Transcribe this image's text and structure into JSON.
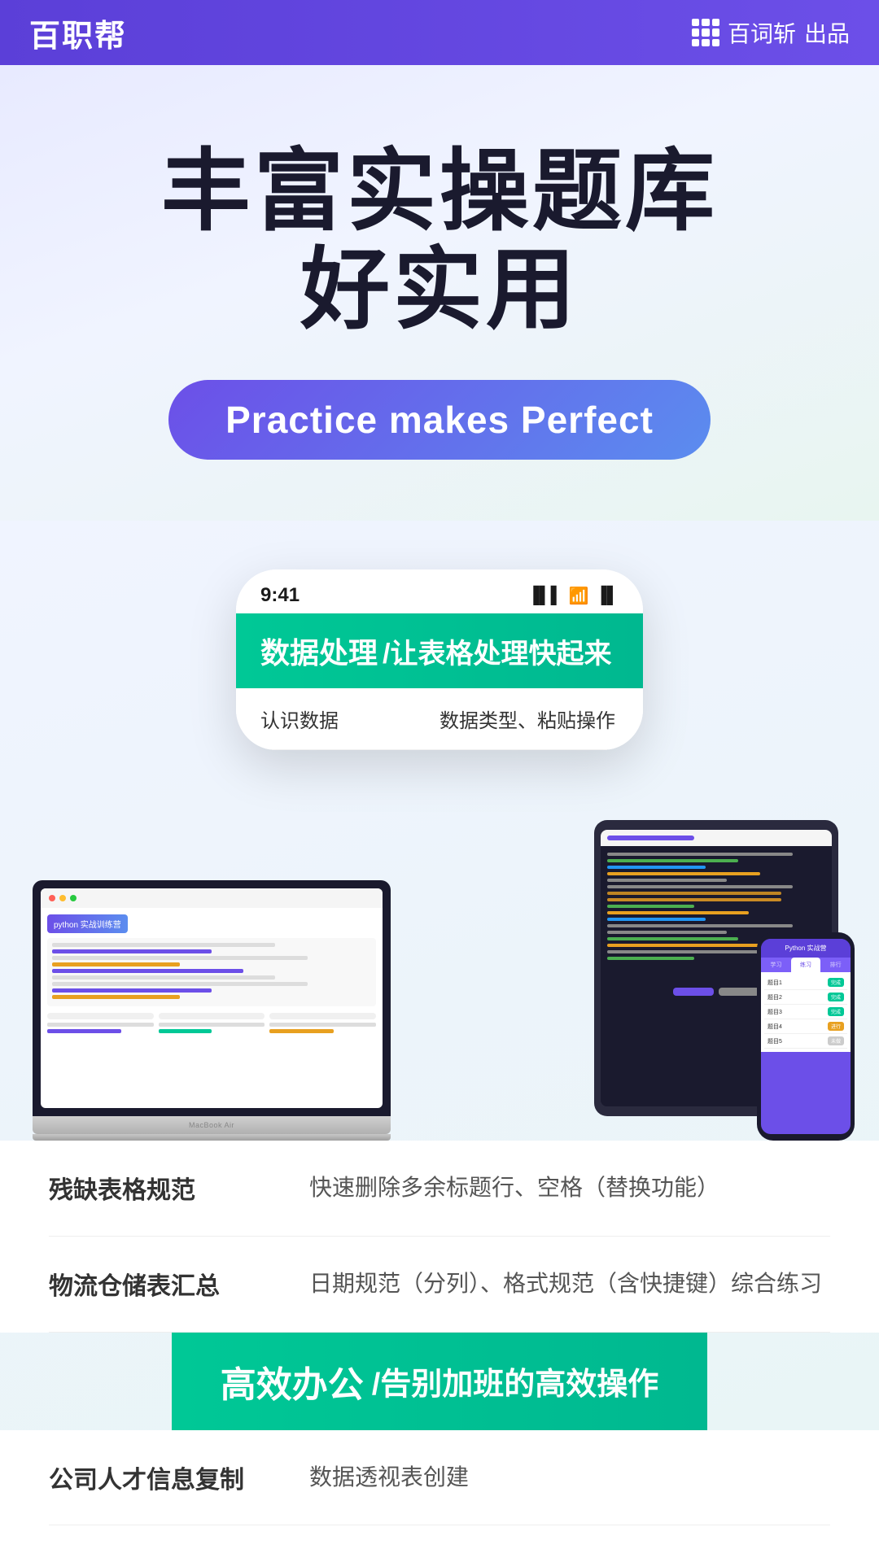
{
  "header": {
    "logo": "百职帮",
    "brand_icon_label": "grid-icon",
    "brand_name": "百词斩",
    "brand_suffix": "出品"
  },
  "hero": {
    "title_line1": "丰富实操题库",
    "title_line2": "好实用",
    "practice_badge": "Practice makes Perfect"
  },
  "phone_mockup": {
    "time": "9:41",
    "data_processing_label": "数据处理",
    "data_processing_subtitle": "/让表格处理快起来",
    "list_rows": [
      {
        "left": "认识数据",
        "right": "数据类型、粘贴操作"
      }
    ]
  },
  "content_rows": [
    {
      "left": "残缺表格规范",
      "right": "快速删除多余标题行、空格（替换功能）"
    },
    {
      "left": "物流仓储表汇总",
      "right": "日期规范（分列）、格式规范（含快捷键）综合练习"
    }
  ],
  "efficiency_banner": {
    "label": "高效办公",
    "subtitle": "/告别加班的高效操作"
  },
  "bottom_rows": [
    {
      "left": "公司人才信息复制",
      "right": "数据透视表创建"
    }
  ],
  "laptop": {
    "label": "MacBook Air",
    "python_label": "python 实战训练营"
  },
  "small_phone": {
    "header": "Python 实战营",
    "tabs": [
      "学习",
      "练习",
      "排行"
    ],
    "rows": [
      {
        "label": "题目1",
        "badge": "完成"
      },
      {
        "label": "题目2",
        "badge": "完成"
      },
      {
        "label": "题目3",
        "badge": "完成"
      },
      {
        "label": "题目4",
        "badge": "进行"
      },
      {
        "label": "题目5",
        "badge": "未做"
      }
    ]
  }
}
